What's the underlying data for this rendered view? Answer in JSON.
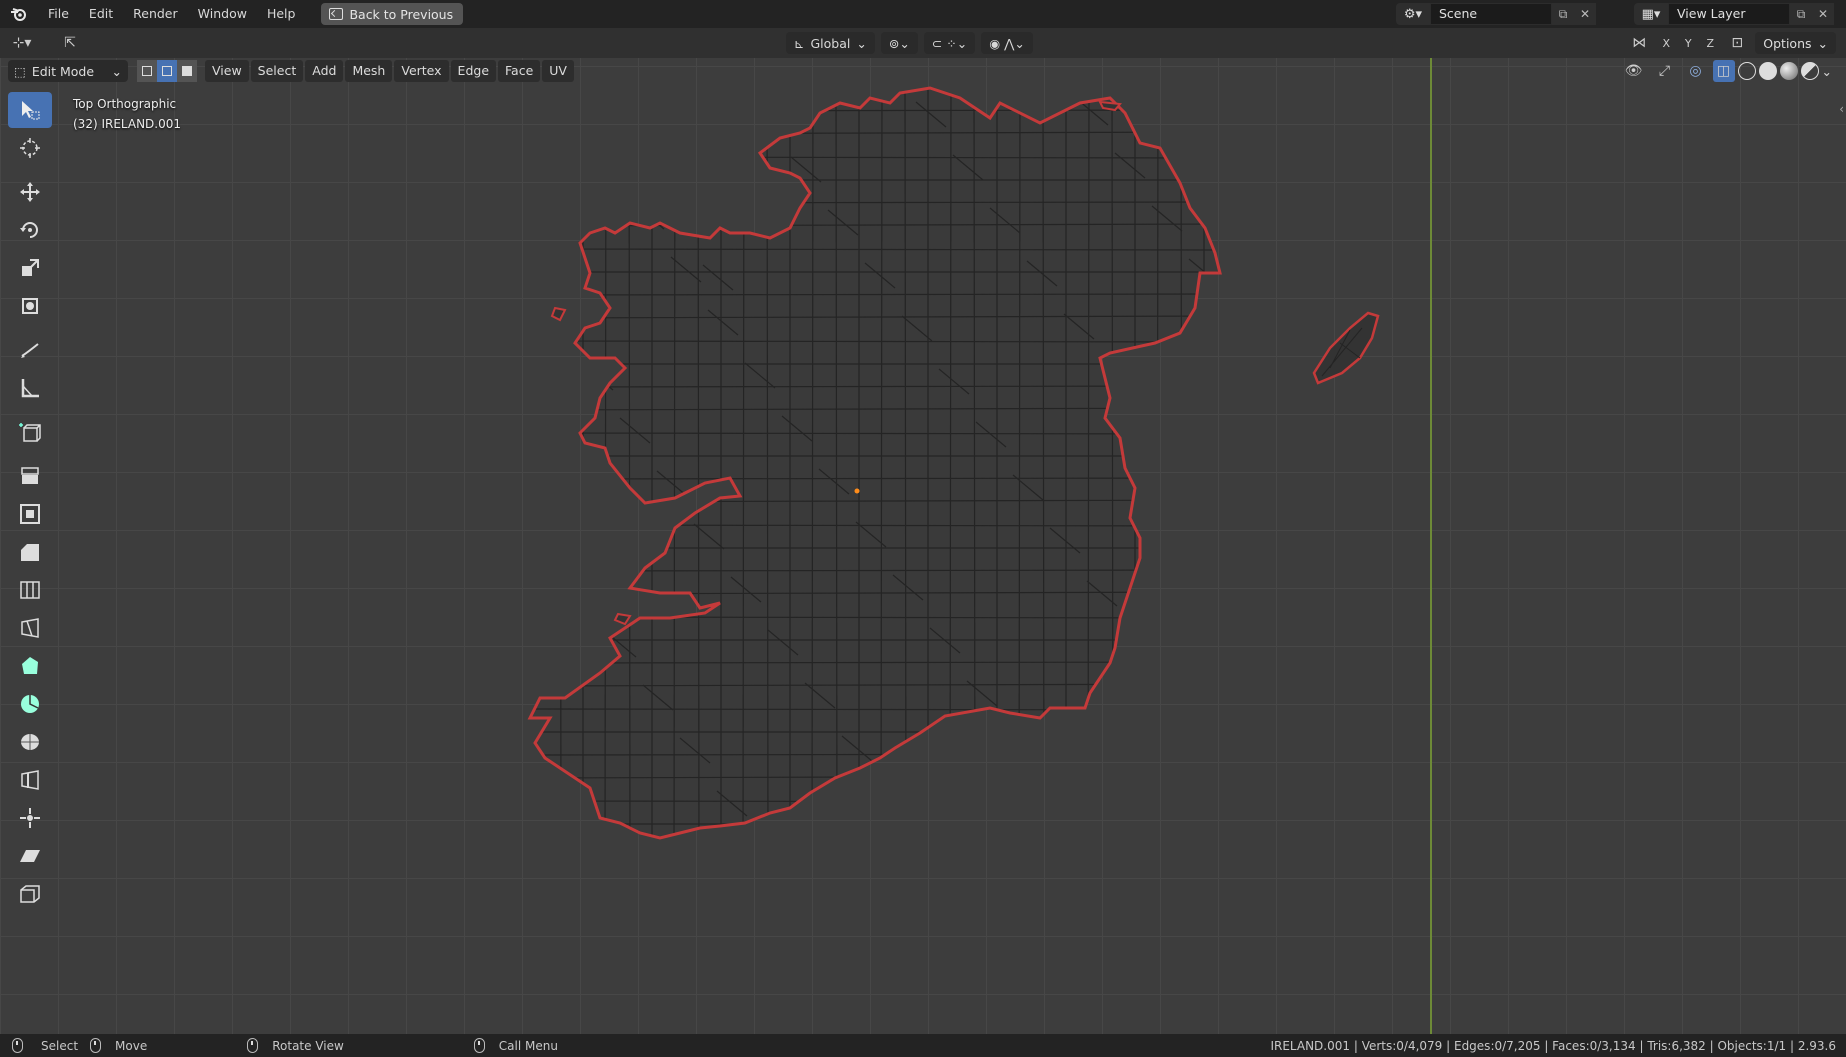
{
  "topbar": {
    "menus": [
      "File",
      "Edit",
      "Render",
      "Window",
      "Help"
    ],
    "back_label": "Back to Previous",
    "scene_label": "Scene",
    "view_layer_label": "View Layer"
  },
  "header": {
    "orientation": "Global",
    "options_label": "Options",
    "axes": [
      "X",
      "Y",
      "Z"
    ]
  },
  "viewport": {
    "mode_label": "Edit Mode",
    "menus": [
      "View",
      "Select",
      "Add",
      "Mesh",
      "Vertex",
      "Edge",
      "Face",
      "UV"
    ],
    "info_line1": "Top Orthographic",
    "info_line2": "(32) IRELAND.001"
  },
  "toolbar": {
    "tools": [
      "select-box-icon",
      "cursor-icon",
      "move-icon",
      "rotate-icon",
      "scale-icon",
      "transform-icon",
      "annotate-icon",
      "measure-icon",
      "add-cube-icon",
      "extrude-icon",
      "inset-icon",
      "bevel-icon",
      "loop-cut-icon",
      "knife-icon",
      "poly-build-icon",
      "spin-icon",
      "smooth-icon",
      "edge-slide-icon",
      "shrink-fatten-icon",
      "shear-icon",
      "rip-icon"
    ]
  },
  "status": {
    "select": "Select",
    "move": "Move",
    "rotate": "Rotate View",
    "call_menu": "Call Menu",
    "stats": "IRELAND.001 | Verts:0/4,079 | Edges:0/7,205 | Faces:0/3,134 | Tris:6,382 | Objects:1/1 | 2.93.6"
  },
  "colors": {
    "accent": "#4772b3",
    "outline": "#c43a3a",
    "y_axis": "#6d8a37",
    "origin": "#ff8c1a"
  }
}
